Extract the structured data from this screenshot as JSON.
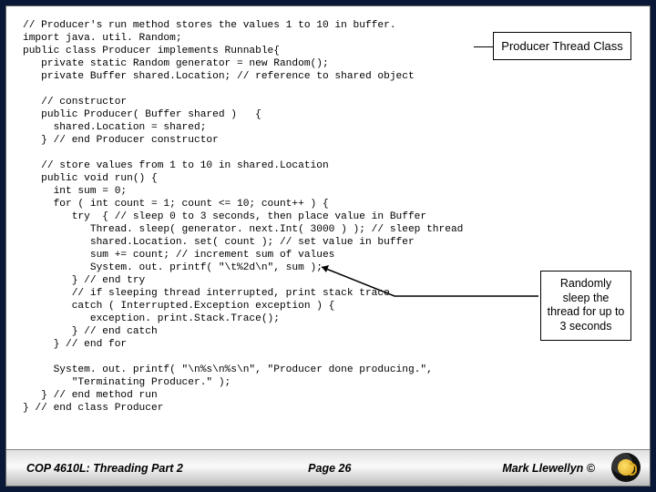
{
  "code": "// Producer's run method stores the values 1 to 10 in buffer.\nimport java. util. Random;\npublic class Producer implements Runnable{\n   private static Random generator = new Random();\n   private Buffer shared.Location; // reference to shared object\n\n   // constructor\n   public Producer( Buffer shared )   {\n     shared.Location = shared;\n   } // end Producer constructor\n\n   // store values from 1 to 10 in shared.Location\n   public void run() {\n     int sum = 0;\n     for ( int count = 1; count <= 10; count++ ) {\n        try  { // sleep 0 to 3 seconds, then place value in Buffer\n           Thread. sleep( generator. next.Int( 3000 ) ); // sleep thread\n           shared.Location. set( count ); // set value in buffer\n           sum += count; // increment sum of values\n           System. out. printf( \"\\t%2d\\n\", sum );\n        } // end try\n        // if sleeping thread interrupted, print stack trace\n        catch ( Interrupted.Exception exception ) {\n           exception. print.Stack.Trace();\n        } // end catch\n     } // end for\n\n     System. out. printf( \"\\n%s\\n%s\\n\", \"Producer done producing.\",\n        \"Terminating Producer.\" );\n   } // end method run\n} // end class Producer",
  "callout1": "Producer Thread Class",
  "callout2": "Randomly sleep the thread for up to 3 seconds",
  "footer": {
    "left": "COP 4610L: Threading Part 2",
    "mid": "Page 26",
    "right": "Mark Llewellyn ©"
  }
}
